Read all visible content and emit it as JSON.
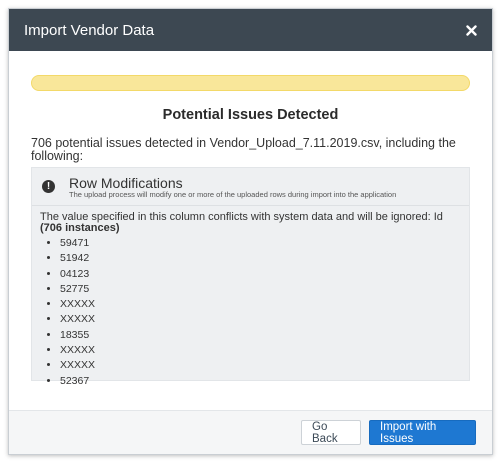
{
  "dialog": {
    "title": "Import Vendor Data",
    "close_icon": "close-icon",
    "progress_color": "#f9e79a",
    "heading": "Potential Issues Detected",
    "summary": "706 potential issues detected in Vendor_Upload_7.11.2019.csv, including the following:"
  },
  "panel": {
    "icon": "exclamation-circle-icon",
    "title": "Row Modifications",
    "subtitle": "The upload process will modify one or more of the uploaded rows during import into the application",
    "conflict_text": "The value specified in this column conflicts with system data and will be ignored: Id ",
    "conflict_count": "(706 instances)",
    "ids": [
      "59471",
      "51942",
      "04123",
      "52775",
      "XXXXX",
      "XXXXX",
      "18355",
      "XXXXX",
      "XXXXX",
      "52367"
    ]
  },
  "footer": {
    "back_label": "Go Back",
    "import_label": "Import with Issues",
    "primary_color": "#1e78d2"
  }
}
